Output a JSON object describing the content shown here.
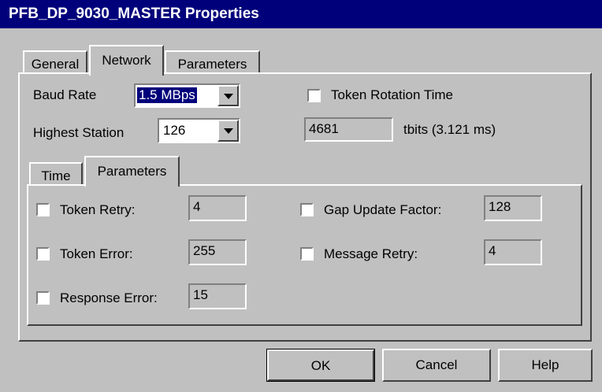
{
  "window": {
    "title": "PFB_DP_9030_MASTER Properties"
  },
  "tabs": [
    {
      "label": "General"
    },
    {
      "label": "Network"
    },
    {
      "label": "Parameters"
    }
  ],
  "network": {
    "baud_rate_label": "Baud Rate",
    "baud_rate_value": "1.5 MBps",
    "highest_station_label": "Highest Station",
    "highest_station_value": "126",
    "token_rotation_label": "Token Rotation Time",
    "token_rotation_checked": false,
    "token_rotation_value": "4681",
    "token_rotation_units": "tbits (3.121 ms)"
  },
  "subtabs": [
    {
      "label": "Time"
    },
    {
      "label": "Parameters"
    }
  ],
  "parameters": [
    {
      "label": "Token Retry:",
      "value": "4",
      "checked": false
    },
    {
      "label": "Token Error:",
      "value": "255",
      "checked": false
    },
    {
      "label": "Response Error:",
      "value": "15",
      "checked": false
    },
    {
      "label": "Gap Update Factor:",
      "value": "128",
      "checked": false
    },
    {
      "label": "Message Retry:",
      "value": "4",
      "checked": false
    }
  ],
  "buttons": {
    "ok": "OK",
    "cancel": "Cancel",
    "help": "Help"
  }
}
